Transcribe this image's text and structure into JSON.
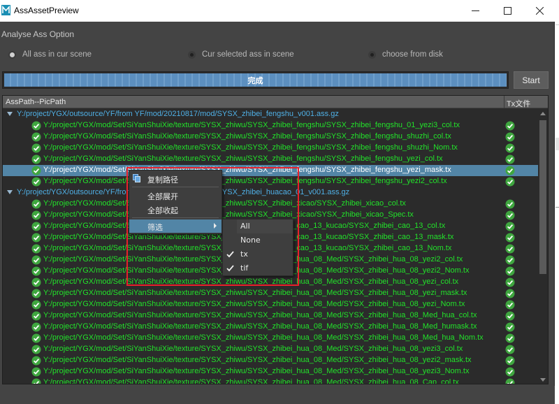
{
  "window": {
    "title": "AssAssetPreview",
    "app_icon": "maya-icon",
    "controls": [
      "minimize-icon",
      "maximize-icon",
      "close-icon"
    ]
  },
  "options": {
    "section_label": "Analyse Ass Option",
    "radios": [
      {
        "label": "All ass in cur scene",
        "checked": true
      },
      {
        "label": "Cur selected ass in scene",
        "checked": false
      },
      {
        "label": "choose from disk",
        "checked": false
      }
    ]
  },
  "progress": {
    "text": "完成",
    "value_percent": 100
  },
  "start_button": {
    "label": "Start"
  },
  "tree": {
    "headers": {
      "path": "AssPath--PicPath",
      "tx": "Tx文件"
    },
    "rows": [
      {
        "type": "group",
        "text": "Y:/project/YGX/outsource/YF/from YF/mod/20210817/mod/SYSX_zhibei_fengshu_v001.ass.gz"
      },
      {
        "type": "child",
        "text": "Y:/project/YGX/mod/Set/SiYanShuiXie/texture/SYSX_zhiwu/SYSX_zhibei_fengshu/SYSX_zhibei_fengshu_01_yezi3_col.tx",
        "status": "ok-icon",
        "tx_status": "ok-icon"
      },
      {
        "type": "child",
        "text": "Y:/project/YGX/mod/Set/SiYanShuiXie/texture/SYSX_zhiwu/SYSX_zhibei_fengshu/SYSX_zhibei_fengshu_shuzhi_col.tx",
        "status": "ok-icon",
        "tx_status": "ok-icon"
      },
      {
        "type": "child",
        "text": "Y:/project/YGX/mod/Set/SiYanShuiXie/texture/SYSX_zhiwu/SYSX_zhibei_fengshu/SYSX_zhibei_fengshu_shuzhi_Nom.tx",
        "status": "ok-icon",
        "tx_status": "ok-icon"
      },
      {
        "type": "child",
        "text": "Y:/project/YGX/mod/Set/SiYanShuiXie/texture/SYSX_zhiwu/SYSX_zhibei_fengshu/SYSX_zhibei_fengshu_yezi_col.tx",
        "status": "ok-icon",
        "tx_status": "ok-icon"
      },
      {
        "type": "child",
        "selected": true,
        "text": "Y:/project/YGX/mod/Set/SiYanShuiXie/texture/SYSX_zhiwu/SYSX_zhibei_fengshu/SYSX_zhibei_fengshu_yezi_mask.tx",
        "status": "ok-icon",
        "tx_status": "ok-icon"
      },
      {
        "type": "child",
        "text": "Y:/project/YGX/mod/Set/SiYanShuiXie/texture/SYSX_zhiwu/SYSX_zhibei_fengshu/SYSX_zhibei_fengshu_yezi2_col.tx",
        "status": "ok-icon",
        "tx_status": "ok-icon"
      },
      {
        "type": "group",
        "text": "Y:/project/YGX/outsource/YF/from YF/mod/20210817/mod/SYSX_zhibei_huacao_01_v001.ass.gz"
      },
      {
        "type": "child",
        "text": "Y:/project/YGX/mod/Set/SiYanShuiXie/texture/SYSX_zhiwu/SYSX_zhibei_xicao/SYSX_zhibei_xicao_col.tx",
        "status": "ok-icon",
        "tx_status": "ok-icon"
      },
      {
        "type": "child",
        "text": "Y:/project/YGX/mod/Set/SiYanShuiXie/texture/SYSX_zhiwu/SYSX_zhibei_xicao/SYSX_zhibei_xicao_Spec.tx",
        "status": "ok-icon",
        "tx_status": "ok-icon"
      },
      {
        "type": "child",
        "text": "Y:/project/YGX/mod/Set/SiYanShuiXie/texture/SYSX_zhiwu/SYSX_zhibei_cao_13_kucao/SYSX_zhibei_cao_13_col.tx",
        "status": "ok-icon",
        "tx_status": "ok-icon"
      },
      {
        "type": "child",
        "text": "Y:/project/YGX/mod/Set/SiYanShuiXie/texture/SYSX_zhiwu/SYSX_zhibei_cao_13_kucao/SYSX_zhibei_cao_13_mask.tx",
        "status": "ok-icon",
        "tx_status": "ok-icon"
      },
      {
        "type": "child",
        "text": "Y:/project/YGX/mod/Set/SiYanShuiXie/texture/SYSX_zhiwu/SYSX_zhibei_cao_13_kucao/SYSX_zhibei_cao_13_Nom.tx",
        "status": "ok-icon",
        "tx_status": "ok-icon"
      },
      {
        "type": "child",
        "text": "Y:/project/YGX/mod/Set/SiYanShuiXie/texture/SYSX_zhiwu/SYSX_zhibei_hua_08_Med/SYSX_zhibei_hua_08_yezi2_col.tx",
        "status": "ok-icon",
        "tx_status": "ok-icon"
      },
      {
        "type": "child",
        "text": "Y:/project/YGX/mod/Set/SiYanShuiXie/texture/SYSX_zhiwu/SYSX_zhibei_hua_08_Med/SYSX_zhibei_hua_08_yezi2_Nom.tx",
        "status": "ok-icon",
        "tx_status": "ok-icon"
      },
      {
        "type": "child",
        "text": "Y:/project/YGX/mod/Set/SiYanShuiXie/texture/SYSX_zhiwu/SYSX_zhibei_hua_08_Med/SYSX_zhibei_hua_08_yezi_col.tx",
        "status": "ok-icon",
        "tx_status": "ok-icon"
      },
      {
        "type": "child",
        "text": "Y:/project/YGX/mod/Set/SiYanShuiXie/texture/SYSX_zhiwu/SYSX_zhibei_hua_08_Med/SYSX_zhibei_hua_08_yezi_mask.tx",
        "status": "ok-icon",
        "tx_status": "ok-icon"
      },
      {
        "type": "child",
        "text": "Y:/project/YGX/mod/Set/SiYanShuiXie/texture/SYSX_zhiwu/SYSX_zhibei_hua_08_Med/SYSX_zhibei_hua_08_yezi_Nom.tx",
        "status": "ok-icon",
        "tx_status": "ok-icon"
      },
      {
        "type": "child",
        "text": "Y:/project/YGX/mod/Set/SiYanShuiXie/texture/SYSX_zhiwu/SYSX_zhibei_hua_08_Med/SYSX_zhibei_hua_08_Med_hua_col.tx",
        "status": "ok-icon",
        "tx_status": "ok-icon"
      },
      {
        "type": "child",
        "text": "Y:/project/YGX/mod/Set/SiYanShuiXie/texture/SYSX_zhiwu/SYSX_zhibei_hua_08_Med/SYSX_zhibei_hua_08_Med_humask.tx",
        "status": "ok-icon",
        "tx_status": "ok-icon"
      },
      {
        "type": "child",
        "text": "Y:/project/YGX/mod/Set/SiYanShuiXie/texture/SYSX_zhiwu/SYSX_zhibei_hua_08_Med/SYSX_zhibei_hua_08_Med_hua_Nom.tx",
        "status": "ok-icon",
        "tx_status": "ok-icon"
      },
      {
        "type": "child",
        "text": "Y:/project/YGX/mod/Set/SiYanShuiXie/texture/SYSX_zhiwu/SYSX_zhibei_hua_08_Med/SYSX_zhibei_hua_08_yezi3_col.tx",
        "status": "ok-icon",
        "tx_status": "ok-icon"
      },
      {
        "type": "child",
        "text": "Y:/project/YGX/mod/Set/SiYanShuiXie/texture/SYSX_zhiwu/SYSX_zhibei_hua_08_Med/SYSX_zhibei_hua_08_yezi2_mask.tx",
        "status": "ok-icon",
        "tx_status": "ok-icon"
      },
      {
        "type": "child",
        "text": "Y:/project/YGX/mod/Set/SiYanShuiXie/texture/SYSX_zhiwu/SYSX_zhibei_hua_08_Med/SYSX_zhibei_hua_08_yezi3_Nom.tx",
        "status": "ok-icon",
        "tx_status": "ok-icon"
      },
      {
        "type": "child",
        "text": "Y:/project/YGX/mod/Set/SiYanShuiXie/texture/SYSX_zhiwu/SYSX_zhibei_hua_08_Med/SYSX_zhibei_hua_08_Cap_col.tx",
        "status": "ok-icon",
        "tx_status": "ok-icon"
      }
    ]
  },
  "context_menu": {
    "items": [
      {
        "label": "复制路径",
        "icon": "copy-icon"
      },
      {
        "label": "全部展开"
      },
      {
        "label": "全部收起"
      },
      {
        "label": "筛选",
        "has_submenu": true
      }
    ],
    "submenu": [
      {
        "label": "All",
        "checked": false
      },
      {
        "label": "None",
        "checked": false
      },
      {
        "label": "tx",
        "checked": true
      },
      {
        "label": "tif",
        "checked": true
      }
    ]
  },
  "colors": {
    "background": "#444444",
    "tree_background": "#2b2b2b",
    "selection": "#5285a6",
    "group_text": "#4fb0e6",
    "child_text": "#22e22a",
    "ok_icon": "#3fa63f",
    "highlight_frame": "#e8202a"
  }
}
